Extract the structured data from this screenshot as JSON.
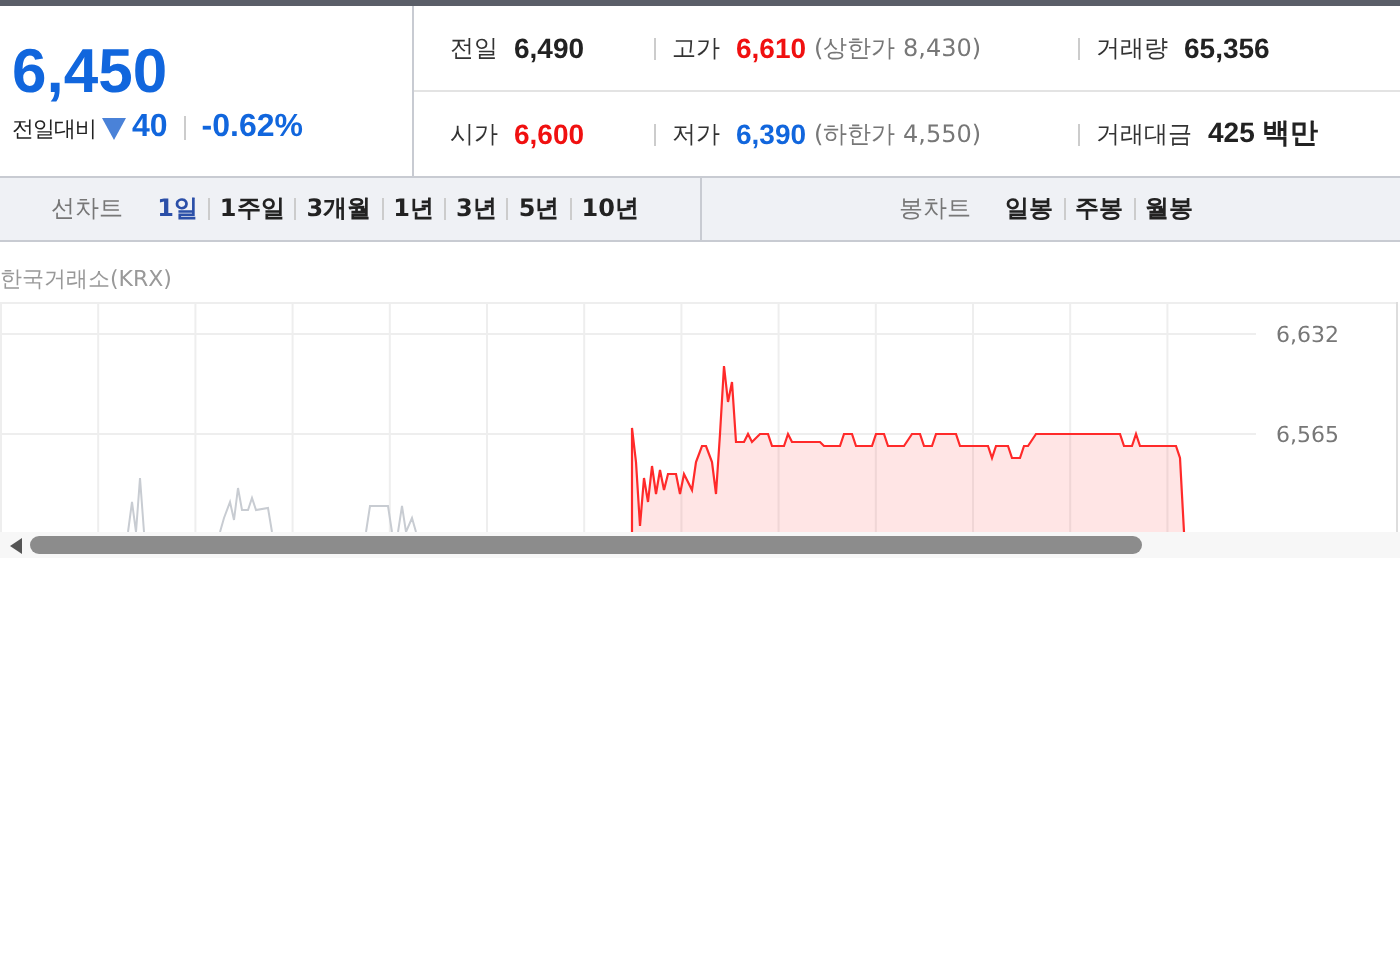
{
  "quote": {
    "price": "6,450",
    "change_label": "전일대비",
    "falling": true,
    "change": "40",
    "change_rate": "-0.62%"
  },
  "stats": [
    [
      {
        "label": "전일",
        "value": "6,490",
        "color": "#222222"
      },
      {
        "label": "고가",
        "value": "6,610",
        "color": "#f01010",
        "limit": "(상한가 8,430)"
      },
      {
        "label": "거래량",
        "value": "65,356",
        "color": "#222222"
      }
    ],
    [
      {
        "label": "시가",
        "value": "6,600",
        "color": "#f01010"
      },
      {
        "label": "저가",
        "value": "6,390",
        "color": "#1166dd",
        "limit": "(하한가 4,550)"
      },
      {
        "label": "거래대금",
        "value": "425 백만",
        "color": "#222222"
      }
    ]
  ],
  "line_chart_tabs": {
    "title": "선차트",
    "items": [
      {
        "label": "1일",
        "selected": true
      },
      {
        "label": "1주일",
        "selected": false
      },
      {
        "label": "3개월",
        "selected": false
      },
      {
        "label": "1년",
        "selected": false
      },
      {
        "label": "3년",
        "selected": false
      },
      {
        "label": "5년",
        "selected": false
      },
      {
        "label": "10년",
        "selected": false
      }
    ]
  },
  "candle_chart_tabs": {
    "title": "봉차트",
    "items": [
      {
        "label": "일봉",
        "selected": false
      },
      {
        "label": "주봉",
        "selected": false
      },
      {
        "label": "월봉",
        "selected": false
      }
    ]
  },
  "chart": {
    "source": "한국거래소(KRX)",
    "y_axis_labels": [
      "6,632",
      "6,565"
    ]
  }
}
